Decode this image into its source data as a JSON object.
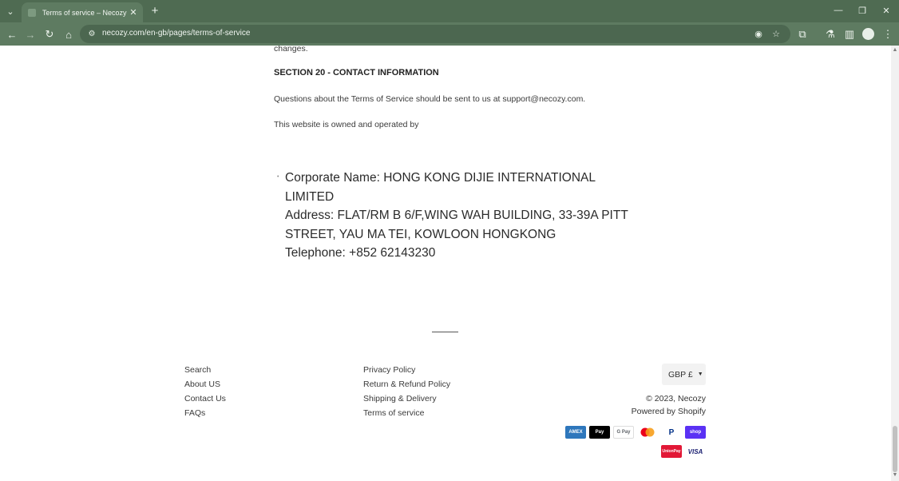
{
  "browser": {
    "tab_title": "Terms of service – Necozy",
    "url": "necozy.com/en-gb/pages/terms-of-service",
    "tab_menu_icon": "⌄",
    "tab_close_icon": "✕",
    "new_tab_icon": "+",
    "minimize_icon": "—",
    "restore_icon": "❐",
    "close_icon": "✕",
    "back_icon": "←",
    "forward_icon": "→",
    "reload_icon": "↻",
    "home_icon": "⌂",
    "site_info_icon": "⚙",
    "eye_off_icon": "◉",
    "star_icon": "☆",
    "extensions_icon": "⧉",
    "labs_icon": "⚗",
    "sidebar_icon": "▥",
    "menu_icon": "⋮"
  },
  "page": {
    "prev_line": "changes.",
    "section_heading": "SECTION 20 - CONTACT INFORMATION",
    "questions_text": "Questions about the Terms of Service should be sent to us at support@necozy.com.",
    "owned_text": "This website is owned and operated by",
    "bullet": "•",
    "company": {
      "corporate_name": "Corporate Name: HONG KONG DIJIE INTERNATIONAL LIMITED",
      "address_line1": "Address: FLAT/RM B 6/F,WING WAH BUILDING, 33-39A PITT",
      "address_line2": "STREET, YAU MA TEI, KOWLOON HONGKONG",
      "telephone": "Telephone: +852 62143230"
    }
  },
  "footer": {
    "col1": [
      "Search",
      "About US",
      "Contact Us",
      "FAQs"
    ],
    "col2": [
      "Privacy Policy",
      "Return & Refund Policy",
      "Shipping & Delivery",
      "Terms of service"
    ],
    "currency": "GBP £",
    "currency_caret": "▼",
    "copyright": "© 2023, Necozy",
    "powered_by": "Powered by Shopify",
    "payment_icons": {
      "amex": "AMEX",
      "apple_pay": "Pay",
      "google_pay": "G Pay",
      "mastercard": "",
      "paypal": "P",
      "shop_pay": "shop",
      "unionpay": "UnionPay",
      "visa": "VISA"
    },
    "colors": {
      "amex": "#2e77bc",
      "apple_pay": "#000000",
      "google_pay": "#ffffff",
      "mastercard_red": "#eb001b",
      "mastercard_orange": "#f79e1b",
      "paypal": "#003087",
      "shop_pay": "#5a31f4",
      "unionpay": "#e21836",
      "visa": "#1a1f71"
    }
  }
}
